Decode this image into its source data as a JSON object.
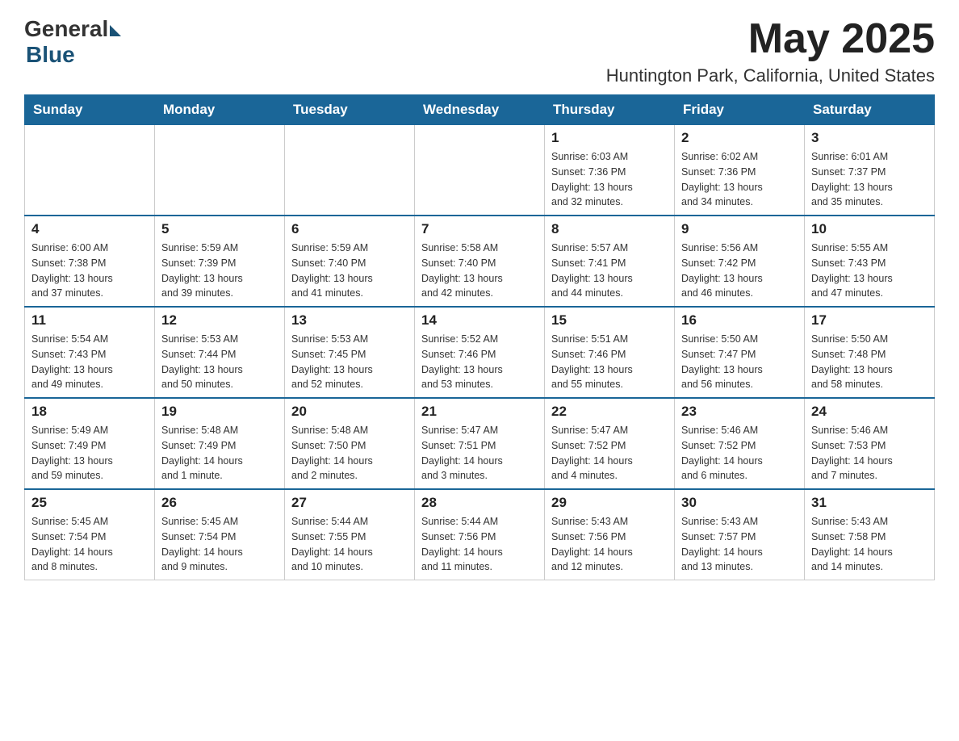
{
  "logo": {
    "general": "General",
    "blue": "Blue"
  },
  "title": "May 2025",
  "location": "Huntington Park, California, United States",
  "days_of_week": [
    "Sunday",
    "Monday",
    "Tuesday",
    "Wednesday",
    "Thursday",
    "Friday",
    "Saturday"
  ],
  "weeks": [
    [
      {
        "day": "",
        "info": ""
      },
      {
        "day": "",
        "info": ""
      },
      {
        "day": "",
        "info": ""
      },
      {
        "day": "",
        "info": ""
      },
      {
        "day": "1",
        "info": "Sunrise: 6:03 AM\nSunset: 7:36 PM\nDaylight: 13 hours\nand 32 minutes."
      },
      {
        "day": "2",
        "info": "Sunrise: 6:02 AM\nSunset: 7:36 PM\nDaylight: 13 hours\nand 34 minutes."
      },
      {
        "day": "3",
        "info": "Sunrise: 6:01 AM\nSunset: 7:37 PM\nDaylight: 13 hours\nand 35 minutes."
      }
    ],
    [
      {
        "day": "4",
        "info": "Sunrise: 6:00 AM\nSunset: 7:38 PM\nDaylight: 13 hours\nand 37 minutes."
      },
      {
        "day": "5",
        "info": "Sunrise: 5:59 AM\nSunset: 7:39 PM\nDaylight: 13 hours\nand 39 minutes."
      },
      {
        "day": "6",
        "info": "Sunrise: 5:59 AM\nSunset: 7:40 PM\nDaylight: 13 hours\nand 41 minutes."
      },
      {
        "day": "7",
        "info": "Sunrise: 5:58 AM\nSunset: 7:40 PM\nDaylight: 13 hours\nand 42 minutes."
      },
      {
        "day": "8",
        "info": "Sunrise: 5:57 AM\nSunset: 7:41 PM\nDaylight: 13 hours\nand 44 minutes."
      },
      {
        "day": "9",
        "info": "Sunrise: 5:56 AM\nSunset: 7:42 PM\nDaylight: 13 hours\nand 46 minutes."
      },
      {
        "day": "10",
        "info": "Sunrise: 5:55 AM\nSunset: 7:43 PM\nDaylight: 13 hours\nand 47 minutes."
      }
    ],
    [
      {
        "day": "11",
        "info": "Sunrise: 5:54 AM\nSunset: 7:43 PM\nDaylight: 13 hours\nand 49 minutes."
      },
      {
        "day": "12",
        "info": "Sunrise: 5:53 AM\nSunset: 7:44 PM\nDaylight: 13 hours\nand 50 minutes."
      },
      {
        "day": "13",
        "info": "Sunrise: 5:53 AM\nSunset: 7:45 PM\nDaylight: 13 hours\nand 52 minutes."
      },
      {
        "day": "14",
        "info": "Sunrise: 5:52 AM\nSunset: 7:46 PM\nDaylight: 13 hours\nand 53 minutes."
      },
      {
        "day": "15",
        "info": "Sunrise: 5:51 AM\nSunset: 7:46 PM\nDaylight: 13 hours\nand 55 minutes."
      },
      {
        "day": "16",
        "info": "Sunrise: 5:50 AM\nSunset: 7:47 PM\nDaylight: 13 hours\nand 56 minutes."
      },
      {
        "day": "17",
        "info": "Sunrise: 5:50 AM\nSunset: 7:48 PM\nDaylight: 13 hours\nand 58 minutes."
      }
    ],
    [
      {
        "day": "18",
        "info": "Sunrise: 5:49 AM\nSunset: 7:49 PM\nDaylight: 13 hours\nand 59 minutes."
      },
      {
        "day": "19",
        "info": "Sunrise: 5:48 AM\nSunset: 7:49 PM\nDaylight: 14 hours\nand 1 minute."
      },
      {
        "day": "20",
        "info": "Sunrise: 5:48 AM\nSunset: 7:50 PM\nDaylight: 14 hours\nand 2 minutes."
      },
      {
        "day": "21",
        "info": "Sunrise: 5:47 AM\nSunset: 7:51 PM\nDaylight: 14 hours\nand 3 minutes."
      },
      {
        "day": "22",
        "info": "Sunrise: 5:47 AM\nSunset: 7:52 PM\nDaylight: 14 hours\nand 4 minutes."
      },
      {
        "day": "23",
        "info": "Sunrise: 5:46 AM\nSunset: 7:52 PM\nDaylight: 14 hours\nand 6 minutes."
      },
      {
        "day": "24",
        "info": "Sunrise: 5:46 AM\nSunset: 7:53 PM\nDaylight: 14 hours\nand 7 minutes."
      }
    ],
    [
      {
        "day": "25",
        "info": "Sunrise: 5:45 AM\nSunset: 7:54 PM\nDaylight: 14 hours\nand 8 minutes."
      },
      {
        "day": "26",
        "info": "Sunrise: 5:45 AM\nSunset: 7:54 PM\nDaylight: 14 hours\nand 9 minutes."
      },
      {
        "day": "27",
        "info": "Sunrise: 5:44 AM\nSunset: 7:55 PM\nDaylight: 14 hours\nand 10 minutes."
      },
      {
        "day": "28",
        "info": "Sunrise: 5:44 AM\nSunset: 7:56 PM\nDaylight: 14 hours\nand 11 minutes."
      },
      {
        "day": "29",
        "info": "Sunrise: 5:43 AM\nSunset: 7:56 PM\nDaylight: 14 hours\nand 12 minutes."
      },
      {
        "day": "30",
        "info": "Sunrise: 5:43 AM\nSunset: 7:57 PM\nDaylight: 14 hours\nand 13 minutes."
      },
      {
        "day": "31",
        "info": "Sunrise: 5:43 AM\nSunset: 7:58 PM\nDaylight: 14 hours\nand 14 minutes."
      }
    ]
  ]
}
